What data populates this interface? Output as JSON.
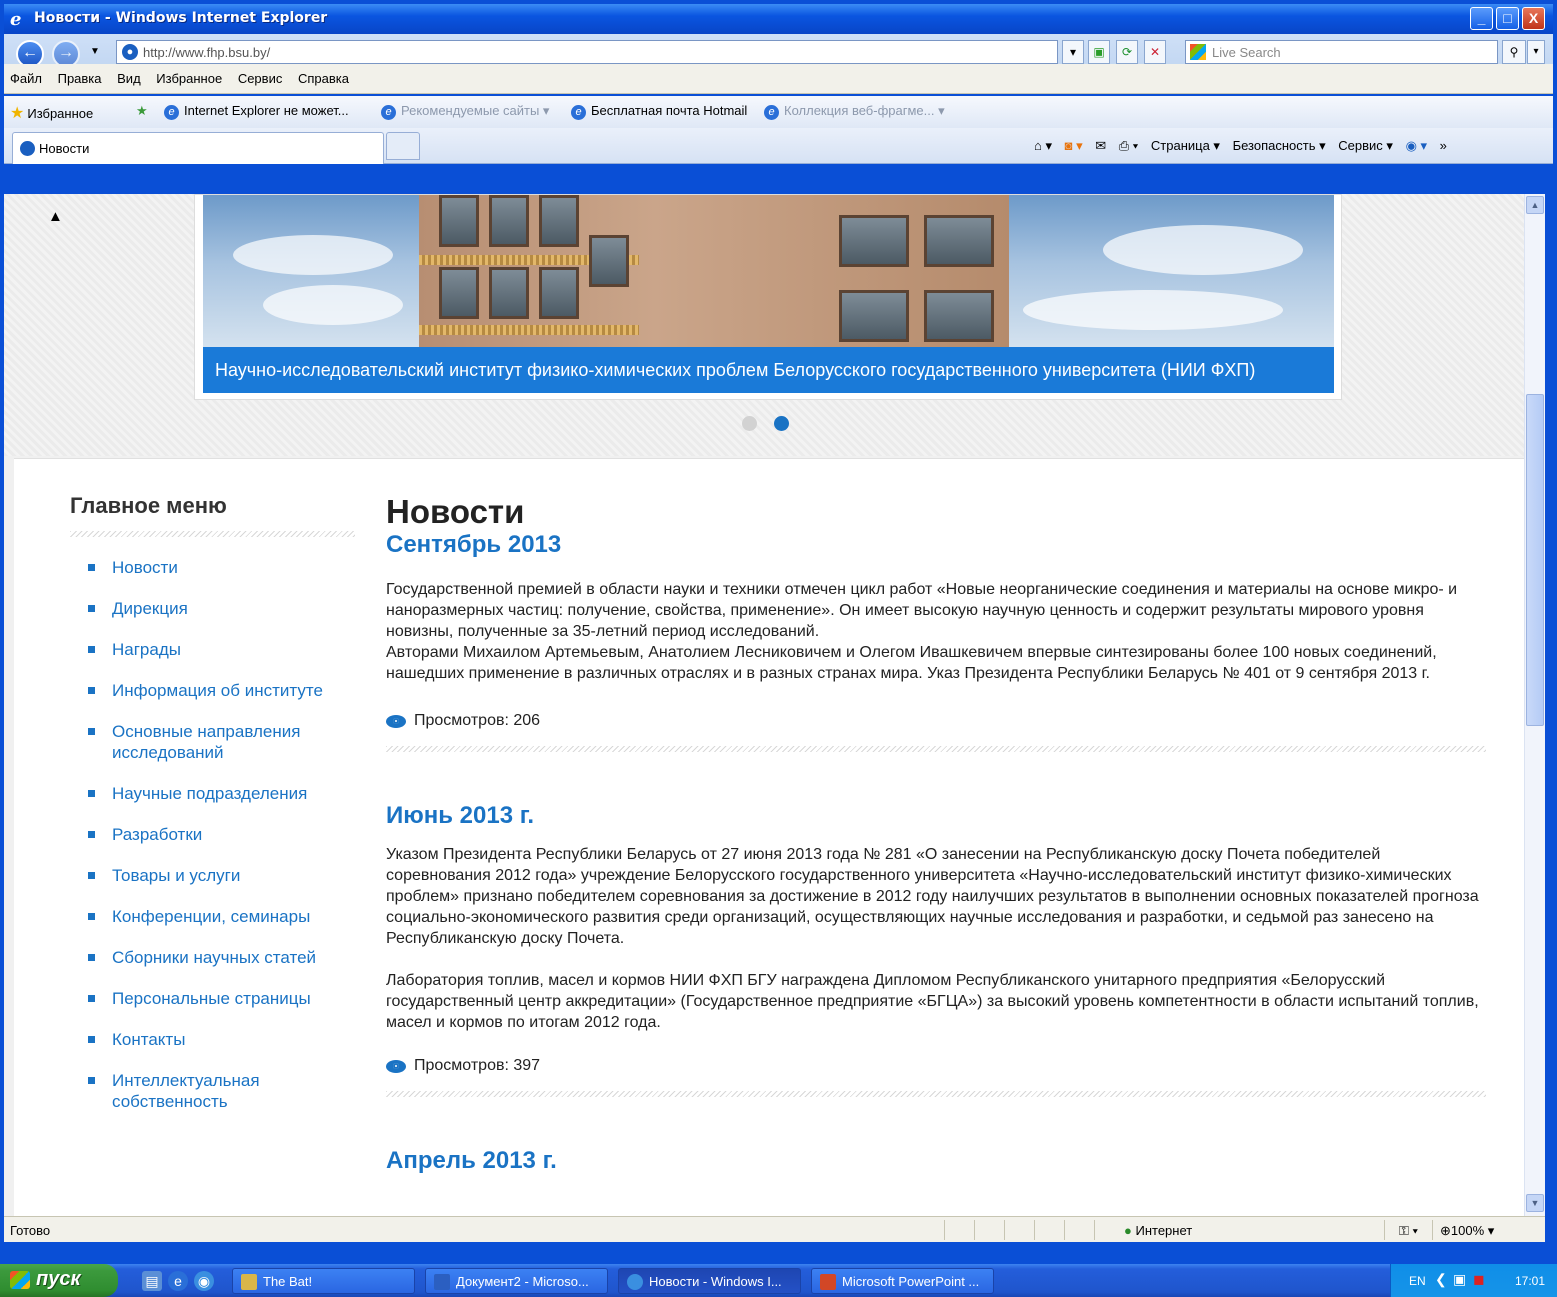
{
  "window": {
    "title": "Новости - Windows Internet Explorer",
    "minimize_glyph": "_",
    "maximize_glyph": "□",
    "close_glyph": "X"
  },
  "address_bar": {
    "url": "http://www.fhp.bsu.by/",
    "search_placeholder": "Live Search"
  },
  "menu": [
    "Файл",
    "Правка",
    "Вид",
    "Избранное",
    "Сервис",
    "Справка"
  ],
  "favorites_bar": {
    "favorites_label": "Избранное",
    "items": [
      {
        "label": "Internet Explorer не может...",
        "dim": false
      },
      {
        "label": "Рекомендуемые сайты ▾",
        "dim": true
      },
      {
        "label": "Бесплатная почта Hotmail",
        "dim": false
      },
      {
        "label": "Коллекция веб-фрагме... ▾",
        "dim": true
      }
    ]
  },
  "tabs": {
    "active_label": "Новости"
  },
  "command_bar": {
    "page_label": "Страница ▾",
    "security_label": "Безопасность ▾",
    "tools_label": "Сервис ▾"
  },
  "hero": {
    "caption": "Научно-исследовательский институт физико-химических проблем Белорусского государственного университета (НИИ ФХП)",
    "slide_count": 2,
    "active_slide": 2
  },
  "sidebar": {
    "title": "Главное меню",
    "items": [
      "Новости",
      "Дирекция",
      "Награды",
      "Информация об институте",
      "Основные направления\nисследований",
      "Научные подразделения",
      "Разработки",
      "Товары и услуги",
      "Конференции, семинары",
      "Сборники научных статей",
      "Персональные страницы",
      "Контакты",
      "Интеллектуальная\nсобственность"
    ]
  },
  "main": {
    "heading": "Новости",
    "articles": [
      {
        "title": "Сентябрь 2013",
        "body": "  Государственной премией в области науки и техники отмечен цикл работ «Новые неорганические соединения и материалы на основе микро- и наноразмерных частиц: получение, свойства, применение». Он имеет высокую научную ценность и содержит результаты мирового уровня новизны, полученные за 35-летний период исследований.\nАвторами Михаилом Артемьевым, Анатолием Лесниковичем и Олегом Ивашкевичем впервые синтезированы более 100 новых соединений, нашедших применение в различных отраслях и в разных странах мира. Указ Президента Республики Беларусь № 401 от 9 сентября 2013 г.",
        "views": "Просмотров: 206"
      },
      {
        "title": "Июнь 2013 г.",
        "body": " Указом Президента Республики Беларусь от 27 июня 2013 года № 281 «О занесении на Республиканскую доску Почета победителей соревнования 2012 года» учреждение Белорусского государственного университета «Научно-исследовательский институт физико-химических проблем» признано победителем соревнования за достижение в 2012 году наилучших результатов в выполнении основных показателей прогноза социально-экономического развития среди организаций, осуществляющих научные исследования и разработки, и седьмой раз занесено на Республиканскую доску Почета.\n\nЛаборатория топлив, масел и кормов НИИ ФХП БГУ награждена Дипломом Республиканского унитарного предприятия «Белорусский государственный центр аккредитации» (Государственное предприятие «БГЦА») за высокий уровень компетентности в области испытаний топлив, масел и кормов по итогам 2012 года.",
        "views": "Просмотров: 397"
      },
      {
        "title": "Апрель 2013 г."
      }
    ]
  },
  "status_bar": {
    "status": "Готово",
    "zone": "Интернет",
    "zoom": "100%"
  },
  "taskbar": {
    "start_label": "пуск",
    "tasks": [
      {
        "label": "The Bat!",
        "active": false
      },
      {
        "label": "Документ2 - Microso...",
        "active": false
      },
      {
        "label": "Новости - Windows I...",
        "active": true
      },
      {
        "label": "Microsoft PowerPoint ...",
        "active": false
      }
    ],
    "language": "EN",
    "clock": "17:01"
  },
  "colors": {
    "link_blue": "#1a73c4",
    "caption_bar": "#1a7ad8",
    "xp_blue": "#0a4fd6",
    "start_green": "#3c9a3d"
  }
}
